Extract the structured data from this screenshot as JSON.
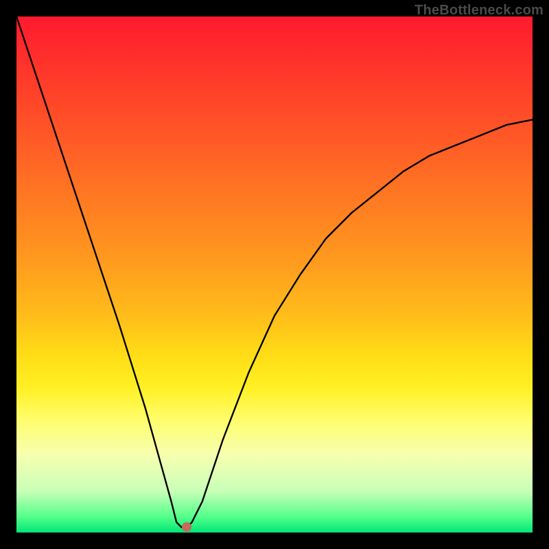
{
  "watermark": "TheBottleneck.com",
  "chart_data": {
    "type": "line",
    "title": "",
    "xlabel": "",
    "ylabel": "",
    "xlim": [
      0,
      100
    ],
    "ylim": [
      0,
      100
    ],
    "grid": false,
    "legend": false,
    "series": [
      {
        "name": "bottleneck-curve",
        "x": [
          0,
          5,
          10,
          15,
          20,
          25,
          30,
          31,
          32,
          33,
          34,
          36,
          38,
          40,
          45,
          50,
          55,
          60,
          65,
          70,
          75,
          80,
          85,
          90,
          95,
          100
        ],
        "values": [
          100,
          85,
          70,
          55,
          40,
          24,
          6,
          2,
          1,
          1,
          2,
          6,
          12,
          18,
          31,
          42,
          50,
          57,
          62,
          66,
          70,
          73,
          75,
          77,
          79,
          80
        ]
      }
    ],
    "marker": {
      "x": 33,
      "y": 1,
      "color": "#c46a5a"
    },
    "background_gradient": {
      "top": "#ff1a2e",
      "mid": "#ffde16",
      "bottom": "#00e676"
    }
  }
}
